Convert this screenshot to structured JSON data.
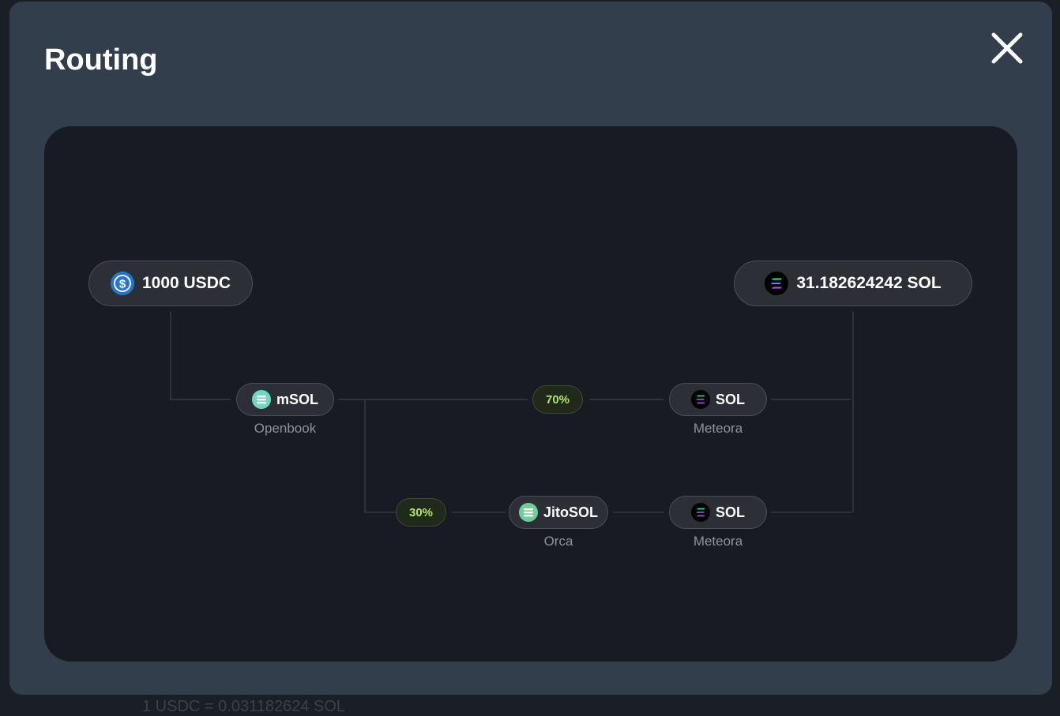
{
  "modal": {
    "title": "Routing"
  },
  "background": {
    "partial_text": "1 USDC = 0.031182624 SOL"
  },
  "route": {
    "input": {
      "label": "1000 USDC",
      "icon": "usdc-icon"
    },
    "output": {
      "label": "31.182624242 SOL",
      "icon": "sol-icon"
    },
    "top_path": {
      "split": "70%",
      "hop1": {
        "token": "mSOL",
        "dex": "Openbook",
        "icon": "msol-icon"
      },
      "hop2": {
        "token": "SOL",
        "dex": "Meteora",
        "icon": "sol-icon"
      }
    },
    "bottom_path": {
      "split": "30%",
      "hop1": {
        "token": "JitoSOL",
        "dex": "Orca",
        "icon": "jitosol-icon"
      },
      "hop2": {
        "token": "SOL",
        "dex": "Meteora",
        "icon": "sol-icon"
      }
    }
  },
  "colors": {
    "modal_bg": "#323e4b",
    "panel_bg": "#181b21",
    "pill_bg": "#2c2f35",
    "split_text": "#b6e36e",
    "usdc": "#2775ca"
  }
}
